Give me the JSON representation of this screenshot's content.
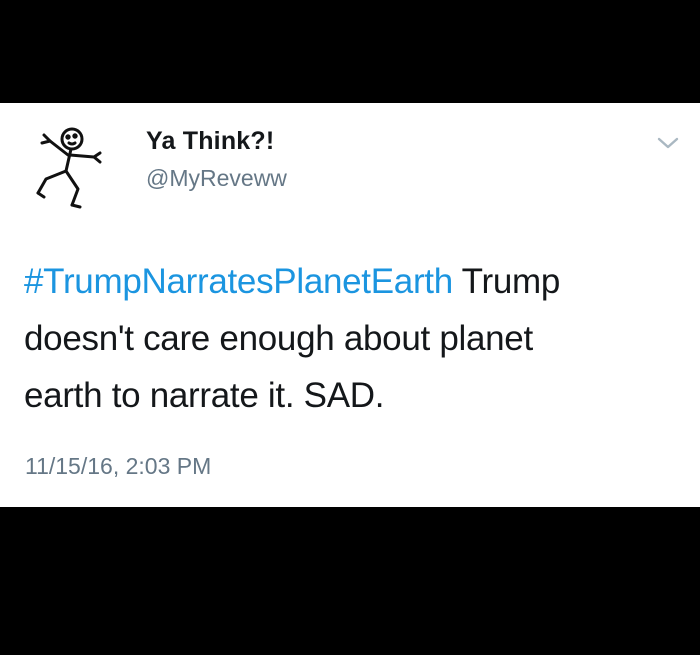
{
  "tweet": {
    "display_name": "Ya Think?!",
    "handle": "@MyReveww",
    "hashtag": "#TrumpNarratesPlanetEarth",
    "text_line1_rest": " Trump",
    "text_line2": "doesn't care enough about planet",
    "text_line3": "earth to narrate it. SAD.",
    "timestamp": "11/15/16, 2:03 PM"
  },
  "icons": {
    "avatar": "stick-figure-avatar",
    "menu": "chevron-down-icon"
  },
  "colors": {
    "link": "#1b95e0",
    "secondary_text": "#657786",
    "primary_text": "#14171a",
    "letterbox": "#000000"
  }
}
